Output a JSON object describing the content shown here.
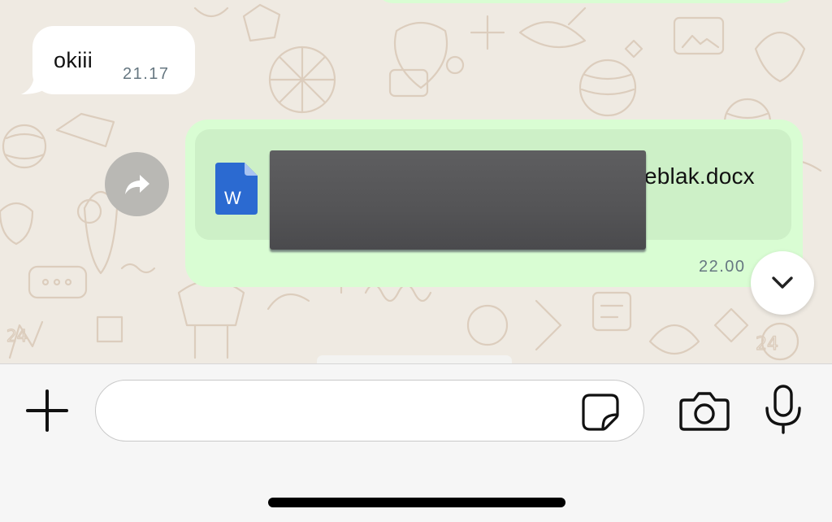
{
  "chat": {
    "messages": [
      {
        "direction": "incoming",
        "text": "okiii",
        "time": "21.17"
      },
      {
        "direction": "outgoing",
        "type": "document",
        "filename_visible": "eblak.docx",
        "file_icon": "word-document-icon",
        "time": "22.00"
      }
    ],
    "forward_icon": "forward-arrow-icon",
    "scroll_icon": "chevron-down-icon"
  },
  "composer": {
    "input_value": "",
    "attach_icon": "plus-icon",
    "sticker_icon": "sticker-icon",
    "camera_icon": "camera-icon",
    "mic_icon": "microphone-icon"
  },
  "colors": {
    "wallpaper": "#efeae2",
    "incoming_bubble": "#ffffff",
    "outgoing_bubble": "#d9fdd3",
    "document_card": "#cdf0c7",
    "word_blue": "#2b6ad1",
    "timestamp": "#667781"
  }
}
